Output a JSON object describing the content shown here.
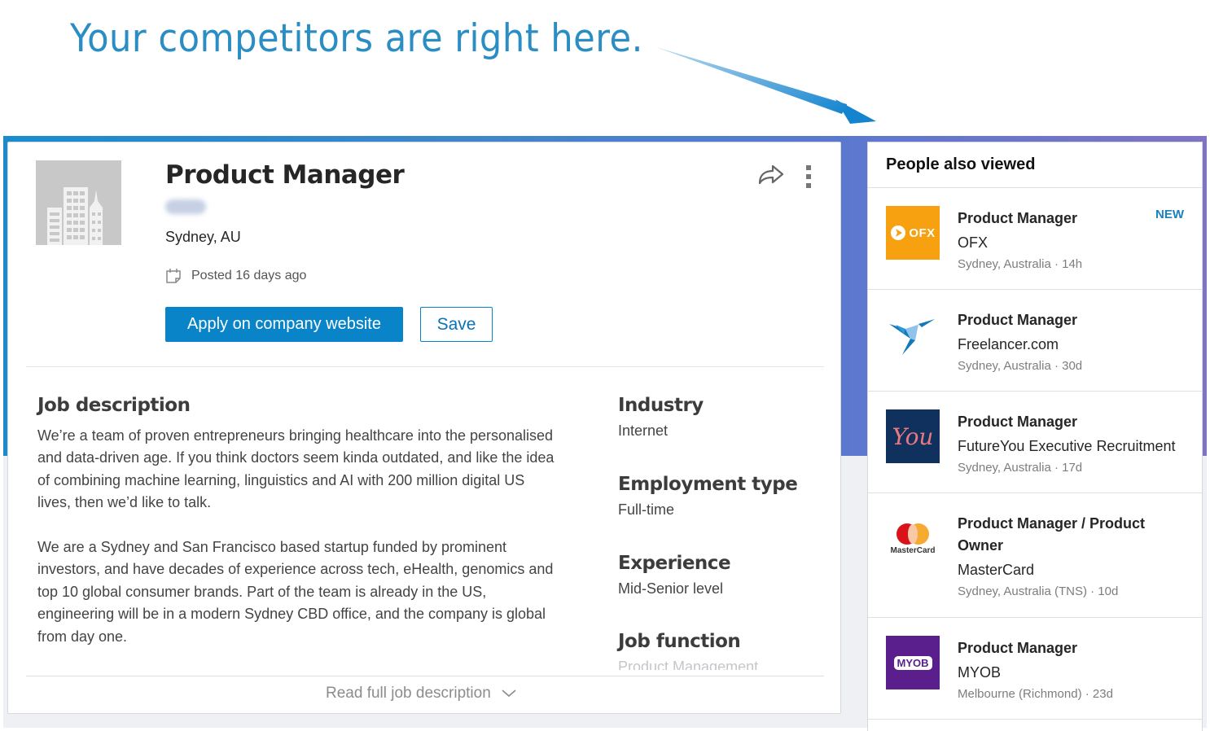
{
  "annotation": {
    "headline": "Your competitors are right here.",
    "colors": {
      "headline": "#2a8dc4",
      "arrow": "#1484cf",
      "frame_start": "#1a8ccc",
      "frame_end": "#7f73c4"
    }
  },
  "job": {
    "title": "Product Manager",
    "company": "(blurred)",
    "location": "Sydney, AU",
    "posted": "Posted 16 days ago",
    "apply_label": "Apply on company website",
    "save_label": "Save",
    "accent_color": "#0a84c8"
  },
  "description": {
    "heading": "Job description",
    "paragraphs": [
      "We’re a team of proven entrepreneurs bringing healthcare into the personalised and data-driven age. If you think doctors seem kinda outdated, and like the idea of combining machine learning, linguistics and AI with 200 million digital US lives, then we’d like to talk.",
      "We are a Sydney and San Francisco based startup funded by prominent investors, and have decades of experience across tech, eHealth, genomics and top 10 global consumer brands. Part of the team is already in the US, engineering will be in a modern Sydney CBD office, and the company is global from day one."
    ],
    "read_more_label": "Read full job description"
  },
  "criteria": [
    {
      "label": "Industry",
      "value": "Internet"
    },
    {
      "label": "Employment type",
      "value": "Full-time"
    },
    {
      "label": "Experience",
      "value": "Mid-Senior level"
    },
    {
      "label": "Job function",
      "value": "Product Management"
    }
  ],
  "side_panel": {
    "heading": "People also viewed",
    "items": [
      {
        "title": "Product Manager",
        "company": "OFX",
        "meta": "Sydney, Australia · 14h",
        "badge": "NEW",
        "logo": "ofx-logo"
      },
      {
        "title": "Product Manager",
        "company": "Freelancer.com",
        "meta": "Sydney, Australia · 30d",
        "logo": "freelancer-logo"
      },
      {
        "title": "Product Manager",
        "company": "FutureYou Executive Recruitment",
        "meta": "Sydney, Australia · 17d",
        "logo": "futureyou-logo"
      },
      {
        "title": "Product Manager / Product Owner",
        "company": "MasterCard",
        "meta": "Sydney, Australia (TNS) · 10d",
        "logo": "mastercard-logo",
        "logo_text": "MasterCard"
      },
      {
        "title": "Product Manager",
        "company": "MYOB",
        "meta": "Melbourne (Richmond) · 23d",
        "logo": "myob-logo",
        "logo_text": "MYOB"
      }
    ]
  },
  "logos": {
    "ofx_text": "OFX",
    "futureyou_text": "You"
  }
}
